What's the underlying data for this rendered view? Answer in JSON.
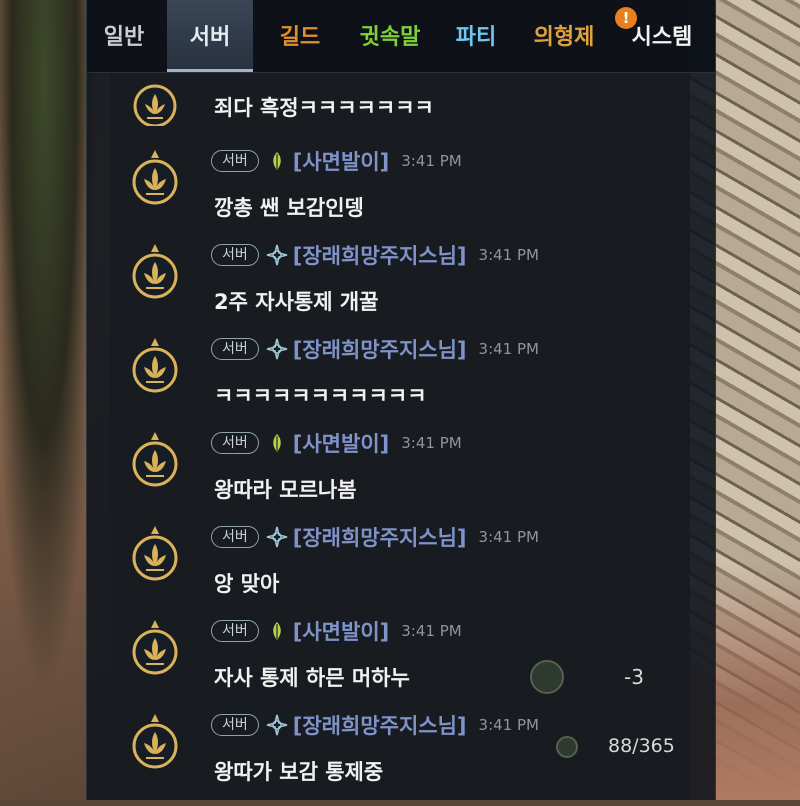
{
  "tabs": [
    {
      "label": "일반",
      "color": "#c9ced4",
      "active": false
    },
    {
      "label": "서버",
      "color": "#e6ecf2",
      "active": true
    },
    {
      "label": "길드",
      "color": "#e0902e",
      "active": false
    },
    {
      "label": "귓속말",
      "color": "#7fd13a",
      "active": false
    },
    {
      "label": "파티",
      "color": "#6fc6f2",
      "active": false
    },
    {
      "label": "의형제",
      "color": "#e0a23a",
      "active": false
    },
    {
      "label": "시스템",
      "color": "#f2f2f2",
      "active": false
    }
  ],
  "system_alert": "!",
  "messages": [
    {
      "channel": "서버",
      "name": "",
      "class_icon": "compass-icon",
      "time": "",
      "text": "죄다 흑정ㅋㅋㅋㅋㅋㅋㅋ"
    },
    {
      "channel": "서버",
      "name": "[사면발이]",
      "class_icon": "leaf-icon",
      "time": "3:41 PM",
      "text": "깡총 쌘 보감인뎅"
    },
    {
      "channel": "서버",
      "name": "[장래희망주지스님]",
      "class_icon": "compass-icon",
      "time": "3:41 PM",
      "text": "2주 자사통제 개꿀"
    },
    {
      "channel": "서버",
      "name": "[장래희망주지스님]",
      "class_icon": "compass-icon",
      "time": "3:41 PM",
      "text": "ㅋㅋㅋㅋㅋㅋㅋㅋㅋㅋㅋ"
    },
    {
      "channel": "서버",
      "name": "[사면발이]",
      "class_icon": "leaf-icon",
      "time": "3:41 PM",
      "text": "왕따라 모르나봄"
    },
    {
      "channel": "서버",
      "name": "[장래희망주지스님]",
      "class_icon": "compass-icon",
      "time": "3:41 PM",
      "text": "앙 맞아"
    },
    {
      "channel": "서버",
      "name": "[사면발이]",
      "class_icon": "leaf-icon",
      "time": "3:41 PM",
      "text": "자사 통제 하믄 머하누"
    },
    {
      "channel": "서버",
      "name": "[장래희망주지스님]",
      "class_icon": "compass-icon",
      "time": "3:41 PM",
      "text": "왕따가 보감 통제중"
    }
  ],
  "hud": {
    "delta": "-3",
    "counter": "88/365"
  },
  "colors": {
    "panel_bg": "#11161e",
    "name": "#7f93c9",
    "emblem_gold": "#d9b25a"
  }
}
